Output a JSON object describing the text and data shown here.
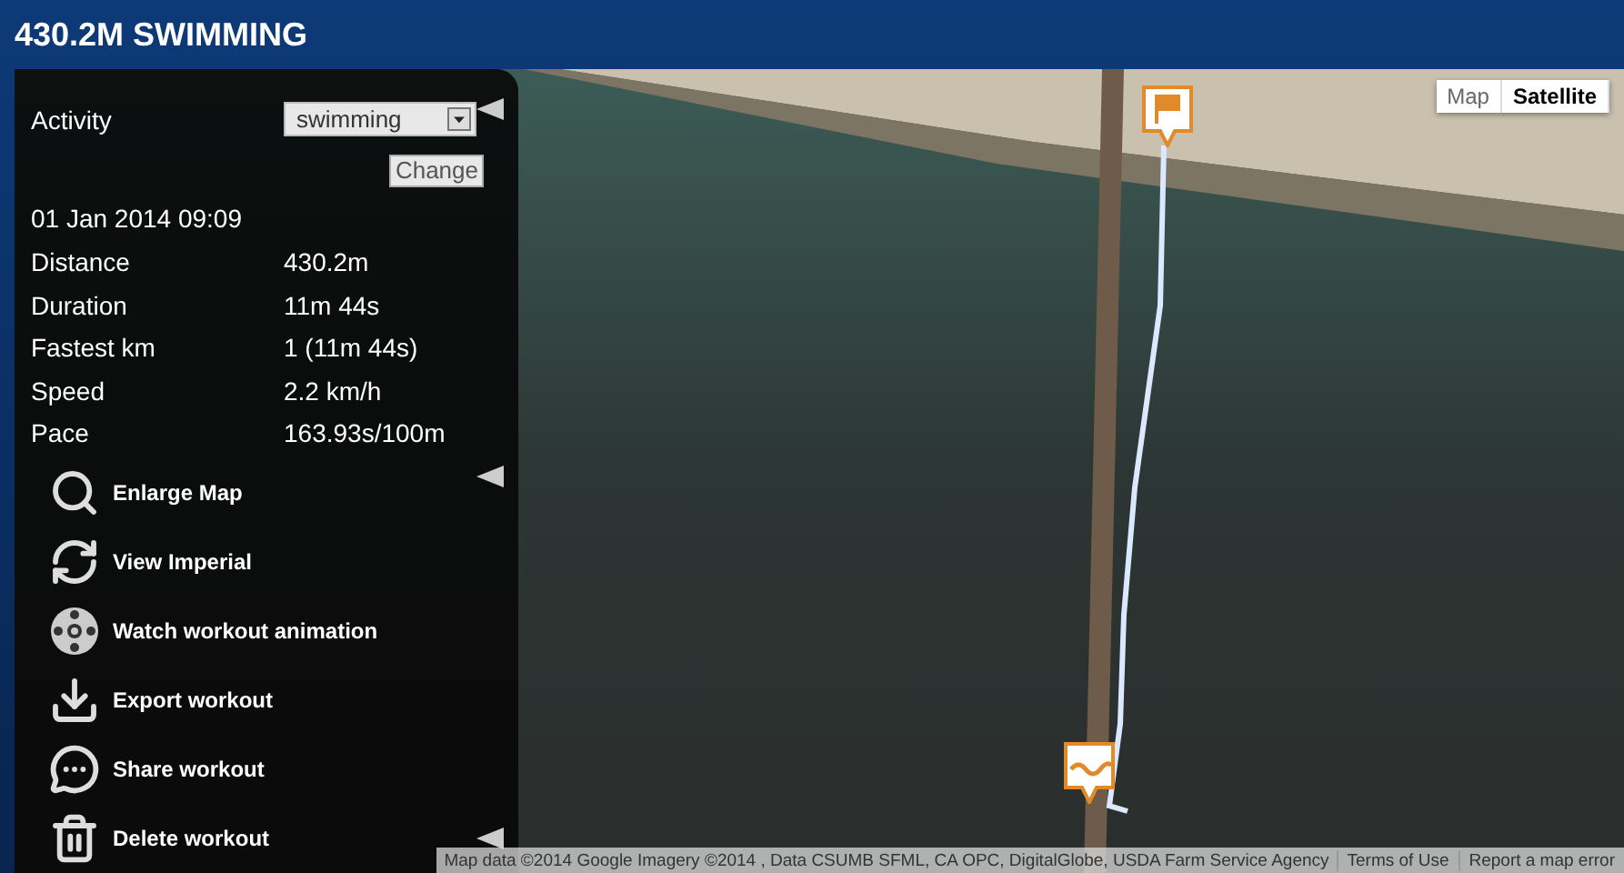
{
  "header": {
    "title": "430.2M SWIMMING"
  },
  "panel": {
    "activity": {
      "label": "Activity",
      "value": "swimming",
      "button": "Change"
    },
    "date": "01 Jan 2014 09:09",
    "stats": [
      {
        "label": "Distance",
        "value": "430.2m"
      },
      {
        "label": "Duration",
        "value": "11m 44s"
      },
      {
        "label": "Fastest km",
        "value": "1 (11m 44s)"
      },
      {
        "label": "Speed",
        "value": "2.2 km/h"
      },
      {
        "label": "Pace",
        "value": "163.93s/100m"
      }
    ],
    "actions": [
      {
        "label": "Enlarge Map"
      },
      {
        "label": "View Imperial"
      },
      {
        "label": "Watch workout animation"
      },
      {
        "label": "Export workout"
      },
      {
        "label": "Share workout"
      },
      {
        "label": "Delete workout"
      }
    ]
  },
  "map": {
    "type_buttons": [
      {
        "label": "Map",
        "selected": false
      },
      {
        "label": "Satellite",
        "selected": true
      }
    ],
    "attribution": "Map data ©2014 Google Imagery ©2014 , Data CSUMB SFML, CA OPC, DigitalGlobe, USDA Farm Service Agency",
    "links": [
      "Terms of Use",
      "Report a map error"
    ]
  }
}
